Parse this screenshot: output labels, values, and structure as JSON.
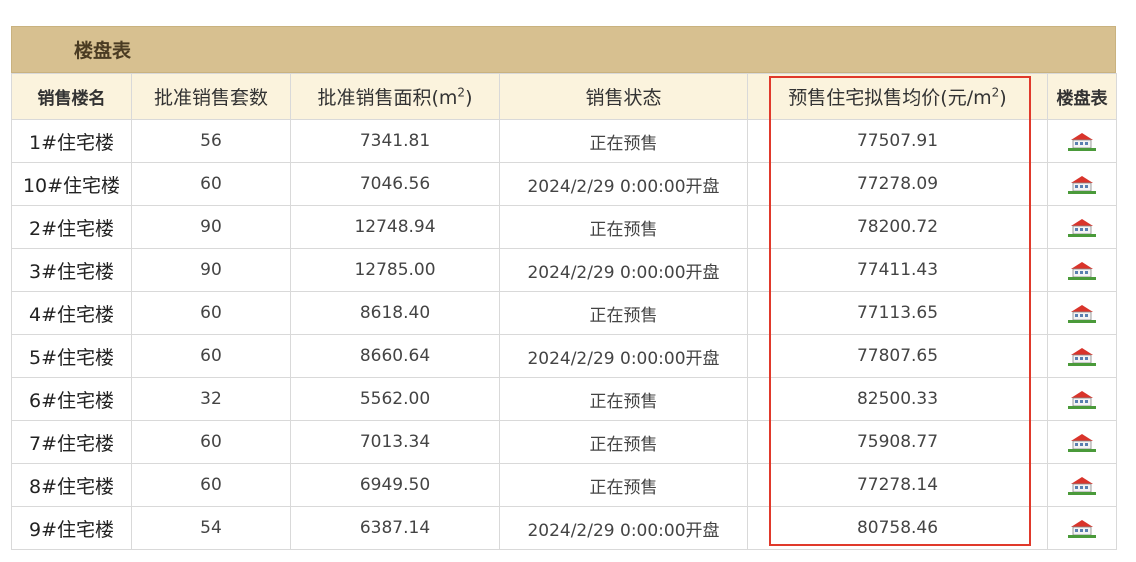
{
  "table": {
    "title": "楼盘表",
    "headers": {
      "building": "销售楼名",
      "approved_units": "批准销售套数",
      "approved_area": "批准销售面积(m",
      "approved_area_sup": "2",
      "approved_area_close": ")",
      "status": "销售状态",
      "avg_price": "预售住宅拟售均价(元/m",
      "avg_price_sup": "2",
      "avg_price_close": ")",
      "plan": "楼盘表"
    },
    "rows": [
      {
        "building": "1#住宅楼",
        "units": "56",
        "area": "7341.81",
        "status": "正在预售",
        "price": "77507.91"
      },
      {
        "building": "10#住宅楼",
        "units": "60",
        "area": "7046.56",
        "status": "2024/2/29 0:00:00开盘",
        "price": "77278.09"
      },
      {
        "building": "2#住宅楼",
        "units": "90",
        "area": "12748.94",
        "status": "正在预售",
        "price": "78200.72"
      },
      {
        "building": "3#住宅楼",
        "units": "90",
        "area": "12785.00",
        "status": "2024/2/29 0:00:00开盘",
        "price": "77411.43"
      },
      {
        "building": "4#住宅楼",
        "units": "60",
        "area": "8618.40",
        "status": "正在预售",
        "price": "77113.65"
      },
      {
        "building": "5#住宅楼",
        "units": "60",
        "area": "8660.64",
        "status": "2024/2/29 0:00:00开盘",
        "price": "77807.65"
      },
      {
        "building": "6#住宅楼",
        "units": "32",
        "area": "5562.00",
        "status": "正在预售",
        "price": "82500.33"
      },
      {
        "building": "7#住宅楼",
        "units": "60",
        "area": "7013.34",
        "status": "正在预售",
        "price": "75908.77"
      },
      {
        "building": "8#住宅楼",
        "units": "60",
        "area": "6949.50",
        "status": "正在预售",
        "price": "77278.14"
      },
      {
        "building": "9#住宅楼",
        "units": "54",
        "area": "6387.14",
        "status": "2024/2/29 0:00:00开盘",
        "price": "80758.46"
      }
    ],
    "icon": "house-icon",
    "colors": {
      "title_bg": "#d7c090",
      "header_bg": "#fbf3dd",
      "highlight": "#e0392b"
    }
  }
}
